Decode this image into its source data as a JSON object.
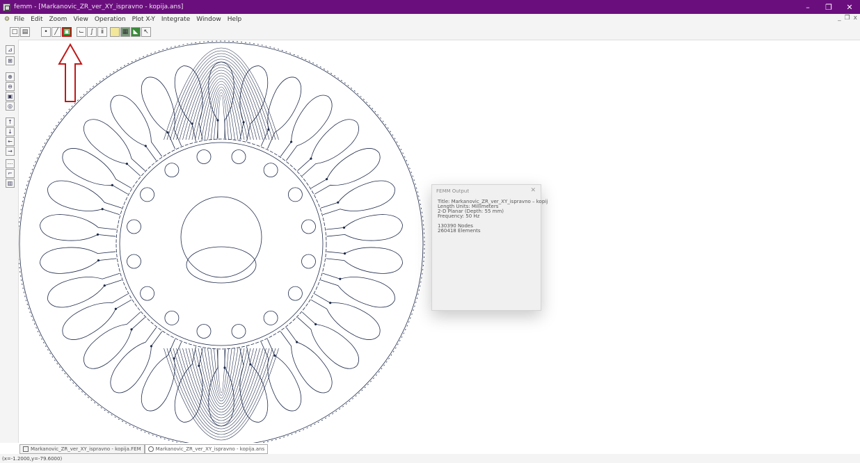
{
  "window": {
    "title": "femm - [Markanovic_ZR_ver_XY_ispravno - kopija.ans]",
    "minimize_glyph": "–",
    "maximize_glyph": "❐",
    "close_glyph": "✕"
  },
  "menu": {
    "items": [
      "File",
      "Edit",
      "Zoom",
      "View",
      "Operation",
      "Plot X-Y",
      "Integrate",
      "Window",
      "Help"
    ],
    "mdi_buttons": [
      "_",
      "❐",
      "x"
    ]
  },
  "toolbar": {
    "icons": [
      "new-file-icon",
      "open-file-icon",
      "point-icon",
      "line-icon",
      "contour-icon",
      "block-integral-icon",
      "plot-icon",
      "info-icon",
      "density-plot-icon",
      "grid-icon",
      "arrow-icon",
      "select-icon"
    ],
    "highlighted": "contour-icon"
  },
  "vtoolbar": {
    "icons": [
      "zoom-in-icon",
      "zoom-out-icon",
      "zoom-window-icon",
      "zoom-natural-icon",
      "pan-up-icon",
      "pan-down-icon",
      "pan-left-icon",
      "pan-right-icon",
      "grid-show-icon",
      "grid-snap-icon",
      "grid-set-icon"
    ]
  },
  "output_dialog": {
    "title": "FEMM Output",
    "close": "✕",
    "lines": [
      "Title: Markanovic_ZR_ver_XY_ispravno – kopij",
      "Length Units: Millimeters",
      "2-D Planar (Depth: 55 mm)",
      "Frequency: 50 Hz"
    ],
    "mesh": {
      "nodes": "130390 Nodes",
      "elements": "260418 Elements"
    }
  },
  "doc_tabs": [
    "Markanovic_ZR_ver_XY_ispravno - kopija.FEM",
    "Markanovic_ZR_ver_XY_ispravno - kopija.ans"
  ],
  "status": {
    "coords": "(x=-1.2000,y=-79.6000)"
  },
  "colors": {
    "title_bar": "#6a0e7d",
    "highlight_arrow": "#c01818",
    "geometry_lines": "#1e2a4a"
  }
}
